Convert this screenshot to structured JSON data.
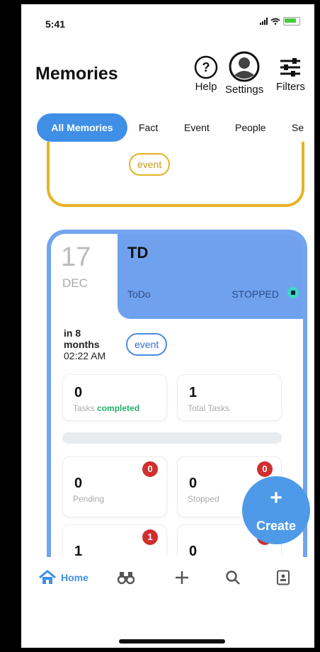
{
  "status": {
    "time": "5:41"
  },
  "header": {
    "title": "Memories",
    "help_label": "Help",
    "settings_label": "Settings",
    "filters_label": "Filters"
  },
  "tabs": [
    {
      "label": "All Memories",
      "active": true
    },
    {
      "label": "Fact"
    },
    {
      "label": "Event"
    },
    {
      "label": "People"
    },
    {
      "label": "Se"
    }
  ],
  "previous_card": {
    "tag": "event"
  },
  "memory_card": {
    "date_day": "17",
    "date_month": "DEC",
    "title": "TD",
    "type": "ToDo",
    "status": "STOPPED",
    "when_line1": "in 8",
    "when_line2": "months",
    "when_time": "02:22 AM",
    "tag": "event",
    "tasks_completed_value": "0",
    "tasks_completed_caption_prefix": "Tasks ",
    "tasks_completed_caption_strong": "completed",
    "total_tasks_value": "1",
    "total_tasks_caption": "Total Tasks",
    "pending_value": "0",
    "pending_caption": "Pending",
    "pending_badge": "0",
    "stopped_value": "0",
    "stopped_caption": "Stopped",
    "stopped_badge": "0",
    "row3_left_value": "1",
    "row3_left_badge": "1",
    "row3_right_value": "0"
  },
  "fab": {
    "label": "Create"
  },
  "bottom_nav": {
    "home_label": "Home"
  },
  "colors": {
    "accent": "#3f8fe6",
    "card_head": "#6fa1ee",
    "previous_card_border": "#e6b324",
    "badge_red": "#d12e2e",
    "completed_green": "#22b06a"
  }
}
